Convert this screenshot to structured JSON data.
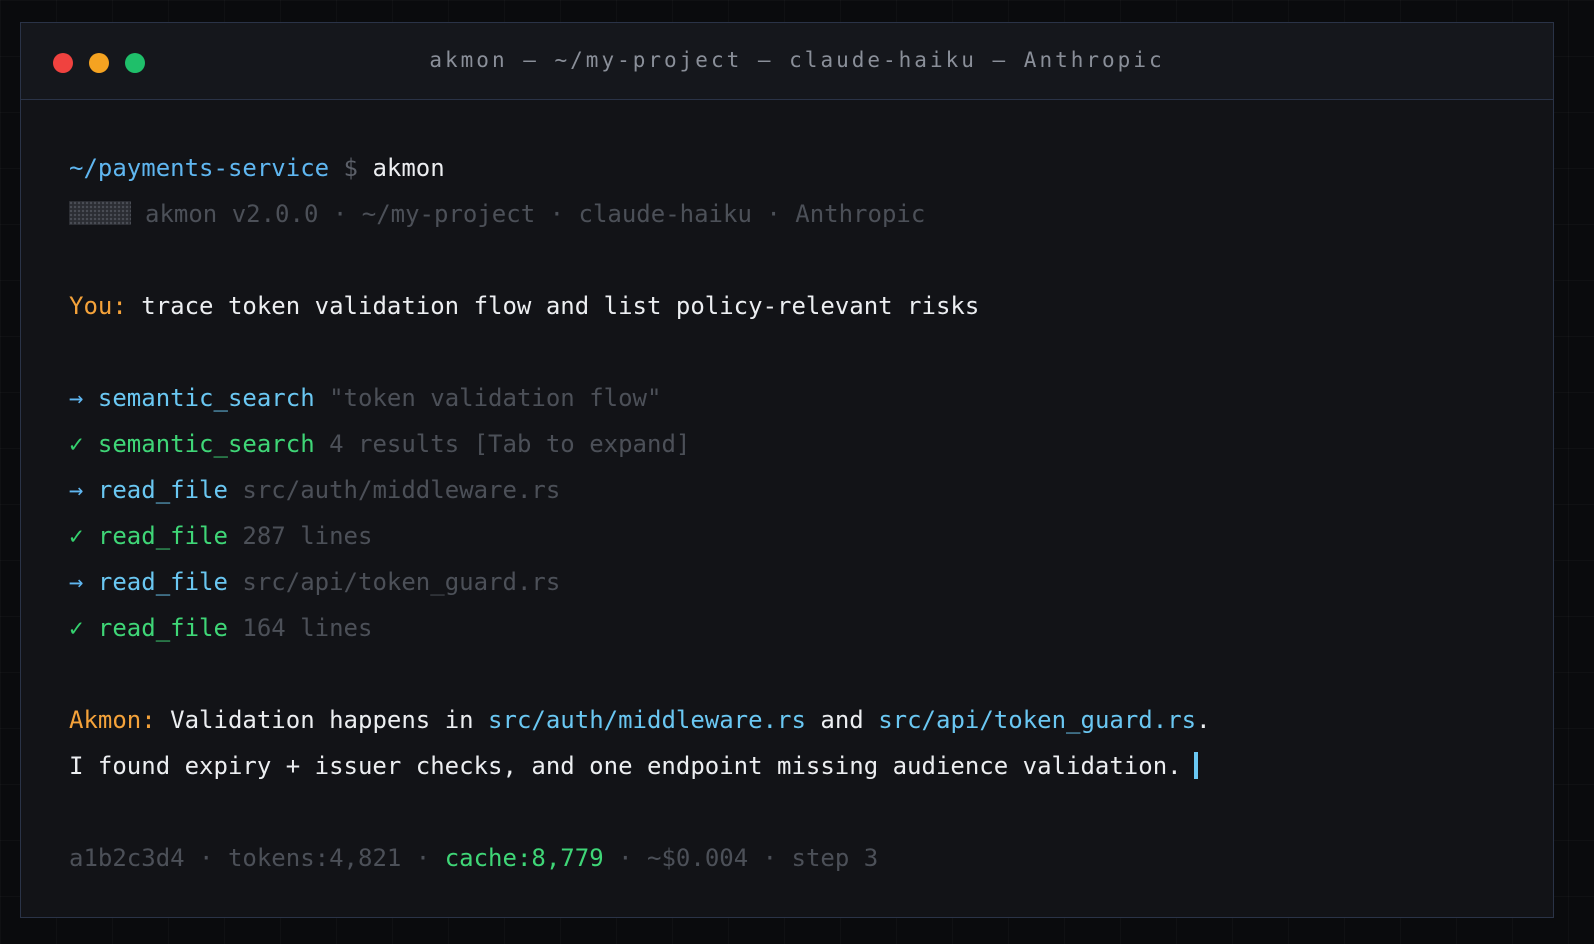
{
  "window": {
    "title": "akmon — ~/my-project — claude-haiku — Anthropic"
  },
  "prompt": {
    "path": "~/payments-service",
    "dollar": "$",
    "command": "akmon"
  },
  "banner": {
    "version": "akmon v2.0.0",
    "sep": "·",
    "project": "~/my-project",
    "model": "claude-haiku",
    "provider": "Anthropic"
  },
  "user": {
    "label": "You:",
    "message": "trace token validation flow and list policy-relevant risks"
  },
  "tool_calls": [
    {
      "marker": "→",
      "name": "semantic_search",
      "detail": "\"token validation flow\"",
      "status": "running"
    },
    {
      "marker": "✓",
      "name": "semantic_search",
      "detail": "4 results [Tab to expand]",
      "status": "done"
    },
    {
      "marker": "→",
      "name": "read_file",
      "detail": "src/auth/middleware.rs",
      "status": "running"
    },
    {
      "marker": "✓",
      "name": "read_file",
      "detail": "287 lines",
      "status": "done"
    },
    {
      "marker": "→",
      "name": "read_file",
      "detail": "src/api/token_guard.rs",
      "status": "running"
    },
    {
      "marker": "✓",
      "name": "read_file",
      "detail": "164 lines",
      "status": "done"
    }
  ],
  "response": {
    "label": "Akmon:",
    "line1_a": "Validation happens in",
    "file1": "src/auth/middleware.rs",
    "line1_b": "and",
    "file2": "src/api/token_guard.rs",
    "line1_c": ".",
    "line2": "I found expiry + issuer checks, and one endpoint missing audience validation."
  },
  "status": {
    "hash": "a1b2c3d4",
    "sep": "·",
    "tokens": "tokens:4,821",
    "cache": "cache:8,779",
    "cost": "~$0.004",
    "step": "step 3"
  },
  "colors": {
    "accent_blue": "#5fb6f0",
    "accent_cyan": "#6ac7f2",
    "accent_green": "#3fd677",
    "accent_orange": "#f4a23a",
    "border": "#2a3347",
    "background": "#121317"
  }
}
